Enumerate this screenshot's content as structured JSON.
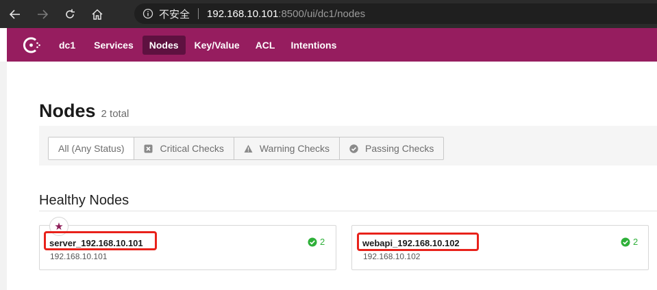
{
  "browser": {
    "security_label": "不安全",
    "url_host": "192.168.10.101",
    "url_rest": ":8500/ui/dc1/nodes"
  },
  "header": {
    "datacenter": "dc1",
    "nav": [
      "Services",
      "Nodes",
      "Key/Value",
      "ACL",
      "Intentions"
    ],
    "active": "Nodes",
    "brand_color": "#961d5f"
  },
  "page": {
    "title": "Nodes",
    "total": "2 total"
  },
  "filters": [
    {
      "label": "All (Any Status)",
      "icon": "none",
      "selected": true
    },
    {
      "label": "Critical Checks",
      "icon": "critical-icon"
    },
    {
      "label": "Warning Checks",
      "icon": "warning-icon"
    },
    {
      "label": "Passing Checks",
      "icon": "passing-icon"
    }
  ],
  "section": {
    "title": "Healthy Nodes"
  },
  "nodes": [
    {
      "name": "server_192.168.10.101",
      "address": "192.168.10.101",
      "passing": "2",
      "leader": true
    },
    {
      "name": "webapi_192.168.10.102",
      "address": "192.168.10.102",
      "passing": "2",
      "leader": false
    }
  ],
  "colors": {
    "passing": "#2eb039",
    "highlight": "#e8211a"
  }
}
